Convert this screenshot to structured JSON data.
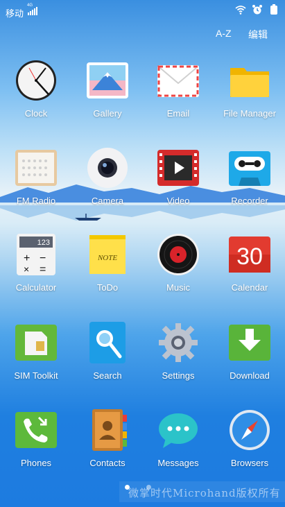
{
  "status": {
    "carrier": "移动",
    "network": "4G"
  },
  "top": {
    "sort_label": "A-Z",
    "edit_label": "编辑"
  },
  "apps": [
    {
      "label": "Clock",
      "icon": "clock-icon"
    },
    {
      "label": "Gallery",
      "icon": "gallery-icon"
    },
    {
      "label": "Email",
      "icon": "email-icon"
    },
    {
      "label": "File Manager",
      "icon": "folder-icon"
    },
    {
      "label": "FM Radio",
      "icon": "radio-icon"
    },
    {
      "label": "Camera",
      "icon": "camera-icon"
    },
    {
      "label": "Video",
      "icon": "video-icon"
    },
    {
      "label": "Recorder",
      "icon": "cassette-icon"
    },
    {
      "label": "Calculator",
      "icon": "calculator-icon"
    },
    {
      "label": "ToDo",
      "icon": "note-icon"
    },
    {
      "label": "Music",
      "icon": "vinyl-icon"
    },
    {
      "label": "Calendar",
      "icon": "calendar-icon"
    },
    {
      "label": "SIM Toolkit",
      "icon": "sim-card-icon"
    },
    {
      "label": "Search",
      "icon": "search-icon"
    },
    {
      "label": "Settings",
      "icon": "gear-icon"
    },
    {
      "label": "Download",
      "icon": "download-icon"
    },
    {
      "label": "Phones",
      "icon": "phone-icon"
    },
    {
      "label": "Contacts",
      "icon": "contacts-book-icon"
    },
    {
      "label": "Messages",
      "icon": "message-bubble-icon"
    },
    {
      "label": "Browsers",
      "icon": "compass-icon"
    }
  ],
  "calc_display": "123",
  "note_text": "NOTE",
  "calendar_day": "30",
  "page_indicator": {
    "pages": 2,
    "current": 1
  },
  "watermark": "微掌时代Microhand版权所有"
}
